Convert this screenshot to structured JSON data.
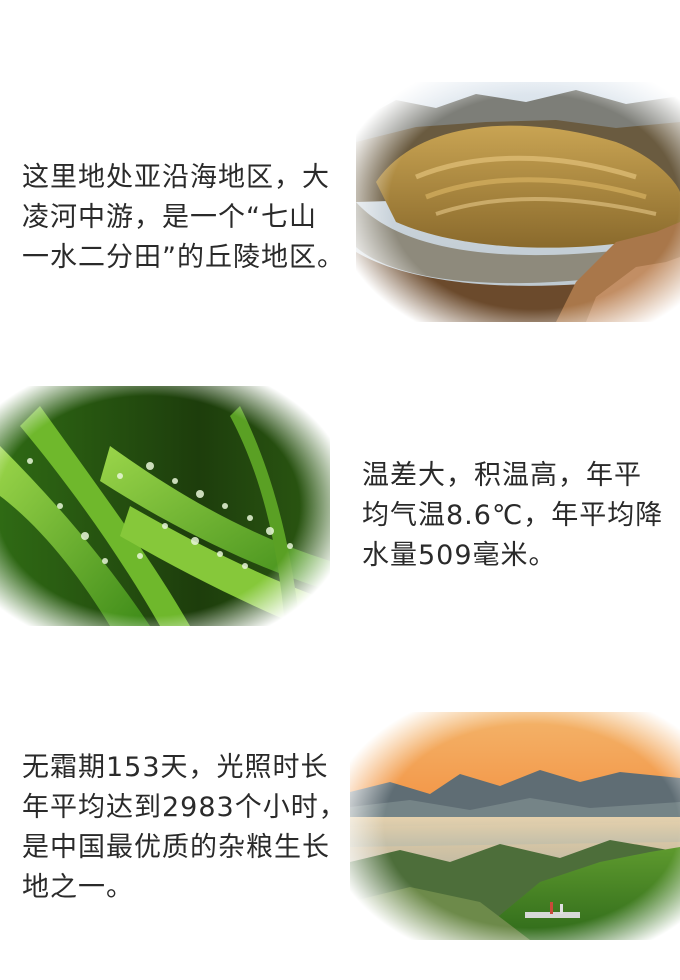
{
  "sections": [
    {
      "lines": [
        "这里地处亚沿海地区，大",
        "凌河中游，是一个“七山",
        "一水二分田”的丘陵地区。"
      ],
      "image": "hills-and-river-farmland-photo"
    },
    {
      "lines": [
        "温差大，积温高，年平",
        "均气温8.6℃，年平均降",
        "水量509毫米。"
      ],
      "image": "green-leaves-with-dew-photo"
    },
    {
      "lines": [
        "无霜期153天，光照时长",
        "年平均达到2983个小时，",
        "是中国最优质的杂粮生长",
        "地之一。"
      ],
      "image": "sunrise-mountain-sea-of-clouds-photo"
    }
  ]
}
